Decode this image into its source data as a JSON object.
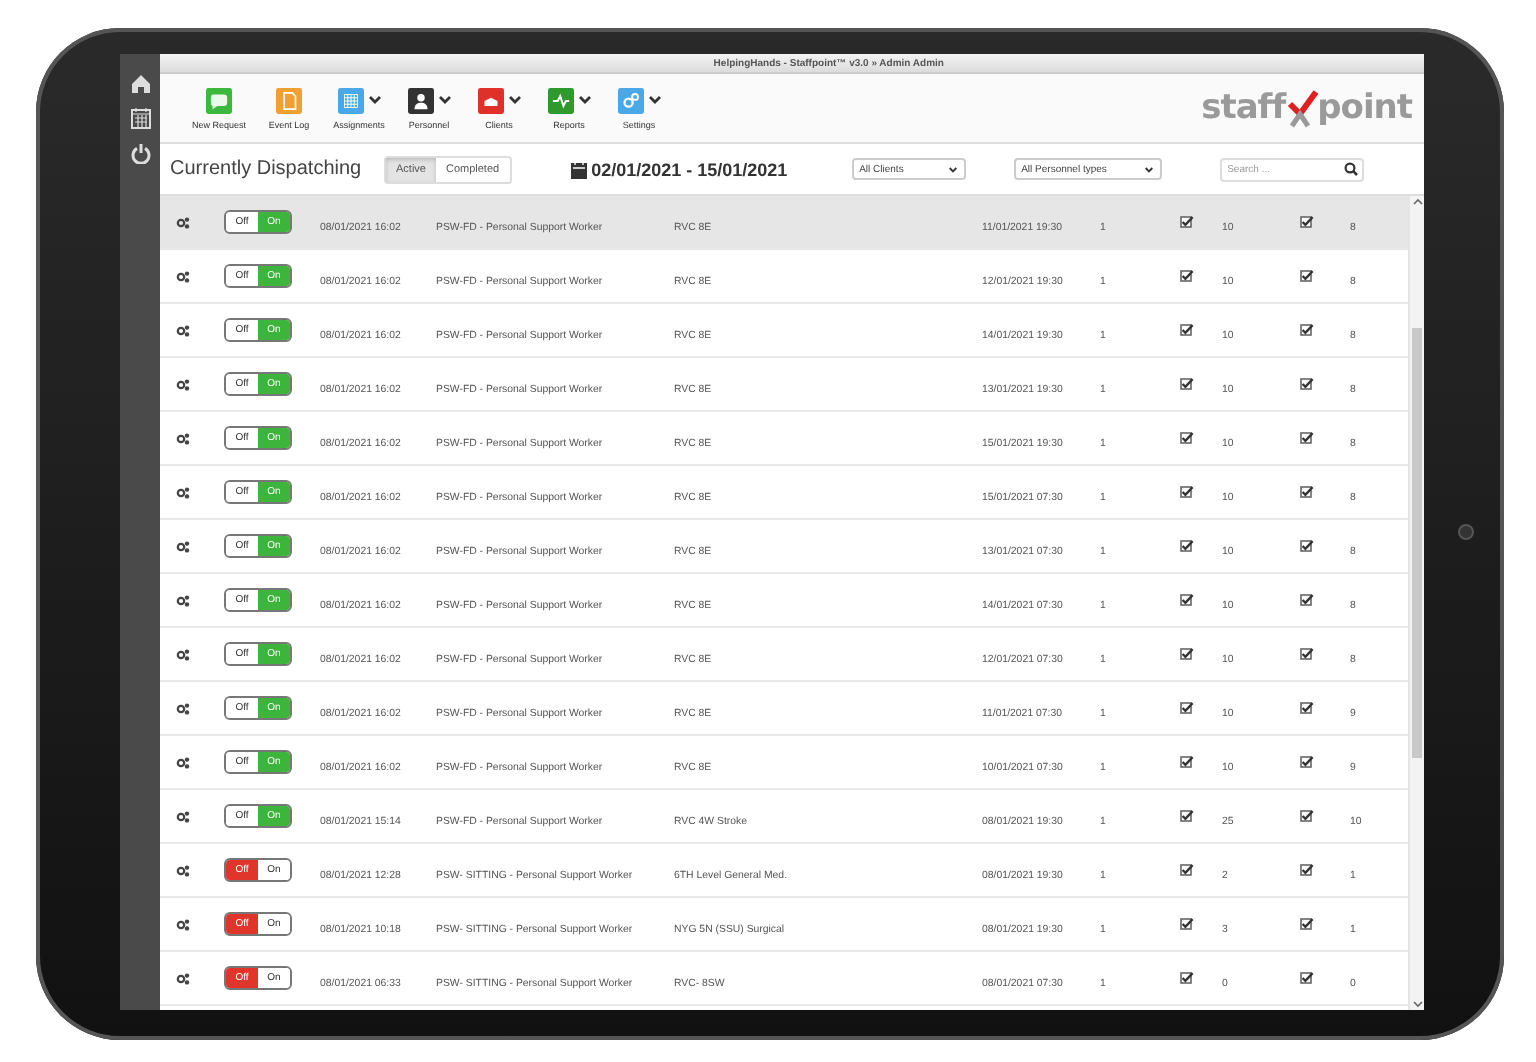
{
  "window": {
    "title": "HelpingHands - Staffpoint™ v3.0 » Admin Admin"
  },
  "toolbar": [
    {
      "label": "New Request",
      "color": "#3cb83c",
      "dropdown": false
    },
    {
      "label": "Event Log",
      "color": "#f0a030",
      "dropdown": false
    },
    {
      "label": "Assignments",
      "color": "#4aa8e8",
      "dropdown": true
    },
    {
      "label": "Personnel",
      "color": "#333333",
      "dropdown": true
    },
    {
      "label": "Clients",
      "color": "#e0302a",
      "dropdown": true
    },
    {
      "label": "Reports",
      "color": "#2e9a2e",
      "dropdown": true
    },
    {
      "label": "Settings",
      "color": "#4aa8e8",
      "dropdown": true
    }
  ],
  "logo": {
    "left": "staff",
    "right": "point"
  },
  "header": {
    "title": "Currently Dispatching",
    "tabs": [
      {
        "label": "Active",
        "selected": true
      },
      {
        "label": "Completed",
        "selected": false
      }
    ],
    "date_range": "02/01/2021 - 15/01/2021",
    "filters": [
      {
        "value": "All Clients"
      },
      {
        "value": "All Personnel types"
      }
    ],
    "search": {
      "placeholder": "Search ..."
    }
  },
  "rows": [
    {
      "highlighted": true,
      "off_label": "Off",
      "on_label": "On",
      "on": true,
      "start": "08/01/2021 16:02",
      "type": "PSW-FD - Personal Support Worker",
      "location": "RVC 8E",
      "end": "11/01/2021 19:30",
      "column_7": "1",
      "column_8_checked": true,
      "column_9": "10",
      "column_10_checked": true,
      "column_11": "8"
    },
    {
      "highlighted": false,
      "off_label": "Off",
      "on_label": "On",
      "on": true,
      "start": "08/01/2021 16:02",
      "type": "PSW-FD - Personal Support Worker",
      "location": "RVC 8E",
      "end": "12/01/2021 19:30",
      "column_7": "1",
      "column_8_checked": true,
      "column_9": "10",
      "column_10_checked": true,
      "column_11": "8"
    },
    {
      "highlighted": false,
      "off_label": "Off",
      "on_label": "On",
      "on": true,
      "start": "08/01/2021 16:02",
      "type": "PSW-FD - Personal Support Worker",
      "location": "RVC 8E",
      "end": "14/01/2021 19:30",
      "column_7": "1",
      "column_8_checked": true,
      "column_9": "10",
      "column_10_checked": true,
      "column_11": "8"
    },
    {
      "highlighted": false,
      "off_label": "Off",
      "on_label": "On",
      "on": true,
      "start": "08/01/2021 16:02",
      "type": "PSW-FD - Personal Support Worker",
      "location": "RVC 8E",
      "end": "13/01/2021 19:30",
      "column_7": "1",
      "column_8_checked": true,
      "column_9": "10",
      "column_10_checked": true,
      "column_11": "8"
    },
    {
      "highlighted": false,
      "off_label": "Off",
      "on_label": "On",
      "on": true,
      "start": "08/01/2021 16:02",
      "type": "PSW-FD - Personal Support Worker",
      "location": "RVC 8E",
      "end": "15/01/2021 19:30",
      "column_7": "1",
      "column_8_checked": true,
      "column_9": "10",
      "column_10_checked": true,
      "column_11": "8"
    },
    {
      "highlighted": false,
      "off_label": "Off",
      "on_label": "On",
      "on": true,
      "start": "08/01/2021 16:02",
      "type": "PSW-FD - Personal Support Worker",
      "location": "RVC 8E",
      "end": "15/01/2021 07:30",
      "column_7": "1",
      "column_8_checked": true,
      "column_9": "10",
      "column_10_checked": true,
      "column_11": "8"
    },
    {
      "highlighted": false,
      "off_label": "Off",
      "on_label": "On",
      "on": true,
      "start": "08/01/2021 16:02",
      "type": "PSW-FD - Personal Support Worker",
      "location": "RVC 8E",
      "end": "13/01/2021 07:30",
      "column_7": "1",
      "column_8_checked": true,
      "column_9": "10",
      "column_10_checked": true,
      "column_11": "8"
    },
    {
      "highlighted": false,
      "off_label": "Off",
      "on_label": "On",
      "on": true,
      "start": "08/01/2021 16:02",
      "type": "PSW-FD - Personal Support Worker",
      "location": "RVC 8E",
      "end": "14/01/2021 07:30",
      "column_7": "1",
      "column_8_checked": true,
      "column_9": "10",
      "column_10_checked": true,
      "column_11": "8"
    },
    {
      "highlighted": false,
      "off_label": "Off",
      "on_label": "On",
      "on": true,
      "start": "08/01/2021 16:02",
      "type": "PSW-FD - Personal Support Worker",
      "location": "RVC 8E",
      "end": "12/01/2021 07:30",
      "column_7": "1",
      "column_8_checked": true,
      "column_9": "10",
      "column_10_checked": true,
      "column_11": "8"
    },
    {
      "highlighted": false,
      "off_label": "Off",
      "on_label": "On",
      "on": true,
      "start": "08/01/2021 16:02",
      "type": "PSW-FD - Personal Support Worker",
      "location": "RVC 8E",
      "end": "11/01/2021 07:30",
      "column_7": "1",
      "column_8_checked": true,
      "column_9": "10",
      "column_10_checked": true,
      "column_11": "9"
    },
    {
      "highlighted": false,
      "off_label": "Off",
      "on_label": "On",
      "on": true,
      "start": "08/01/2021 16:02",
      "type": "PSW-FD - Personal Support Worker",
      "location": "RVC 8E",
      "end": "10/01/2021 07:30",
      "column_7": "1",
      "column_8_checked": true,
      "column_9": "10",
      "column_10_checked": true,
      "column_11": "9"
    },
    {
      "highlighted": false,
      "off_label": "Off",
      "on_label": "On",
      "on": true,
      "start": "08/01/2021 15:14",
      "type": "PSW-FD - Personal Support Worker",
      "location": "RVC 4W Stroke",
      "end": "08/01/2021 19:30",
      "column_7": "1",
      "column_8_checked": true,
      "column_9": "25",
      "column_10_checked": true,
      "column_11": "10"
    },
    {
      "highlighted": false,
      "off_label": "Off",
      "on_label": "On",
      "on": false,
      "start": "08/01/2021 12:28",
      "type": "PSW- SITTING - Personal Support Worker",
      "location": "6TH Level General Med.",
      "end": "08/01/2021 19:30",
      "column_7": "1",
      "column_8_checked": true,
      "column_9": "2",
      "column_10_checked": true,
      "column_11": "1"
    },
    {
      "highlighted": false,
      "off_label": "Off",
      "on_label": "On",
      "on": false,
      "start": "08/01/2021 10:18",
      "type": "PSW- SITTING - Personal Support Worker",
      "location": "NYG 5N (SSU) Surgical",
      "end": "08/01/2021 19:30",
      "column_7": "1",
      "column_8_checked": true,
      "column_9": "3",
      "column_10_checked": true,
      "column_11": "1"
    },
    {
      "highlighted": false,
      "off_label": "Off",
      "on_label": "On",
      "on": false,
      "start": "08/01/2021 06:33",
      "type": "PSW- SITTING - Personal Support Worker",
      "location": "RVC- 8SW",
      "end": "08/01/2021 07:30",
      "column_7": "1",
      "column_8_checked": true,
      "column_9": "0",
      "column_10_checked": true,
      "column_11": "0"
    }
  ]
}
